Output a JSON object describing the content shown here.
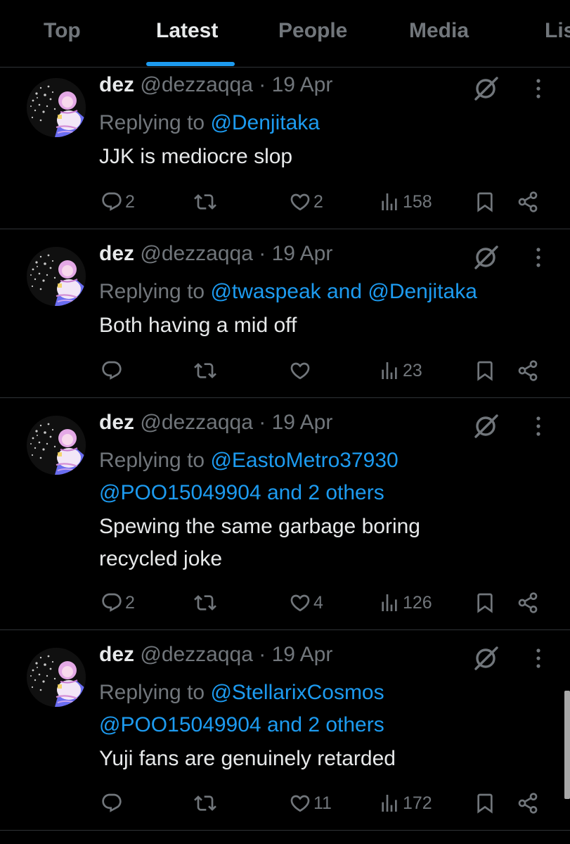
{
  "tabs": [
    {
      "label": "Top"
    },
    {
      "label": "Latest"
    },
    {
      "label": "People"
    },
    {
      "label": "Media"
    },
    {
      "label": "Lis"
    }
  ],
  "active_tab": "Latest",
  "colors": {
    "accent": "#1d9bf0",
    "muted": "#71767b",
    "text": "#e7e9ea",
    "background": "#000000",
    "divider": "#2f3336"
  },
  "icons": {
    "reply": "reply-icon",
    "repost": "repost-icon",
    "like": "heart-icon",
    "views": "views-icon",
    "bookmark": "bookmark-icon",
    "share": "share-icon",
    "grok": "grok-icon",
    "more": "more-icon"
  },
  "tweets": [
    {
      "name": "dez",
      "handle": "@dezzaqqa",
      "separator": "·",
      "date": "19 Apr",
      "replying_prefix": "Replying to ",
      "reply_line_1": "@Denjitaka",
      "text_1": "JJK is mediocre slop",
      "replies": "2",
      "reposts": "",
      "likes": "2",
      "views": "158"
    },
    {
      "name": "dez",
      "handle": "@dezzaqqa",
      "separator": "·",
      "date": "19 Apr",
      "replying_prefix": "Replying to ",
      "reply_mention_a": "@twaspeak",
      "reply_and": " and ",
      "reply_mention_b": "@Denjitaka",
      "text_1": "Both having a mid off",
      "replies": "",
      "reposts": "",
      "likes": "",
      "views": "23"
    },
    {
      "name": "dez",
      "handle": "@dezzaqqa",
      "separator": "·",
      "date": "19 Apr",
      "replying_prefix": "Replying to ",
      "reply_line_1": "@EastoMetro37930",
      "reply_line_2": "@POO15049904 and 2 others",
      "text_1": "Spewing the same garbage boring",
      "text_2": "recycled joke",
      "replies": "2",
      "reposts": "",
      "likes": "4",
      "views": "126"
    },
    {
      "name": "dez",
      "handle": "@dezzaqqa",
      "separator": "·",
      "date": "19 Apr",
      "replying_prefix": "Replying to ",
      "reply_line_1": "@StellarixCosmos",
      "reply_line_2": "@POO15049904 and 2 others",
      "text_1": "Yuji fans are genuinely retarded",
      "replies": "",
      "reposts": "",
      "likes": "11",
      "views": "172"
    }
  ]
}
